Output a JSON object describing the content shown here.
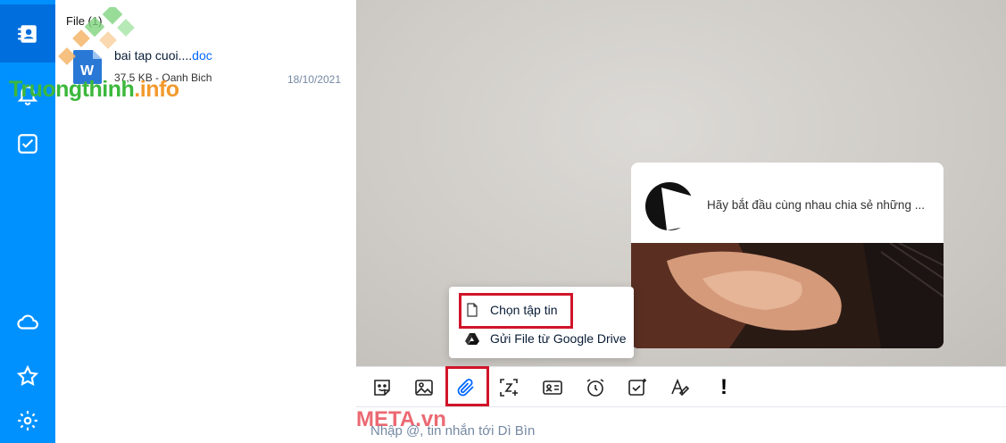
{
  "sidebar": {
    "items": [
      {
        "icon": "contacts-icon",
        "active": true
      },
      {
        "icon": "bell-icon",
        "active": false
      },
      {
        "icon": "todo-checkbox-icon",
        "active": false
      },
      {
        "icon": "cloud-icon",
        "active": false
      },
      {
        "icon": "star-icon",
        "active": false
      },
      {
        "icon": "settings-gear-icon",
        "active": false
      }
    ],
    "background_color": "#0091ff",
    "active_color": "#006edc"
  },
  "file_panel": {
    "title": "File (1)",
    "files": [
      {
        "name": "bai tap cuoi....",
        "ext": "doc",
        "meta": "37,5 KB - Oanh Bich",
        "date": "18/10/2021",
        "icon": "word-doc-icon"
      }
    ]
  },
  "watermark": {
    "brand": "Truongthinh",
    "tld": ".info",
    "meta_brand": "META.vn"
  },
  "chat": {
    "card": {
      "text": "Hãy bắt đầu cùng nhau chia sẻ những ..."
    }
  },
  "attach_menu": {
    "items": [
      {
        "label": "Chọn tập tin",
        "icon": "file-icon",
        "highlighted": true
      },
      {
        "label": "Gửi File từ Google Drive",
        "icon": "google-drive-icon",
        "highlighted": false
      }
    ],
    "highlight_color": "#d0152a"
  },
  "toolbar": {
    "buttons": [
      {
        "icon": "sticker-icon"
      },
      {
        "icon": "image-icon"
      },
      {
        "icon": "paperclip-icon",
        "highlighted": true
      },
      {
        "icon": "screenshot-icon"
      },
      {
        "icon": "contact-card-icon"
      },
      {
        "icon": "alarm-clock-icon"
      },
      {
        "icon": "todo-icon"
      },
      {
        "icon": "text-format-icon"
      },
      {
        "icon": "important-icon",
        "label": "!"
      }
    ]
  },
  "composer": {
    "placeholder": "Nhập @, tin nhắn tới Dì Bìn"
  }
}
